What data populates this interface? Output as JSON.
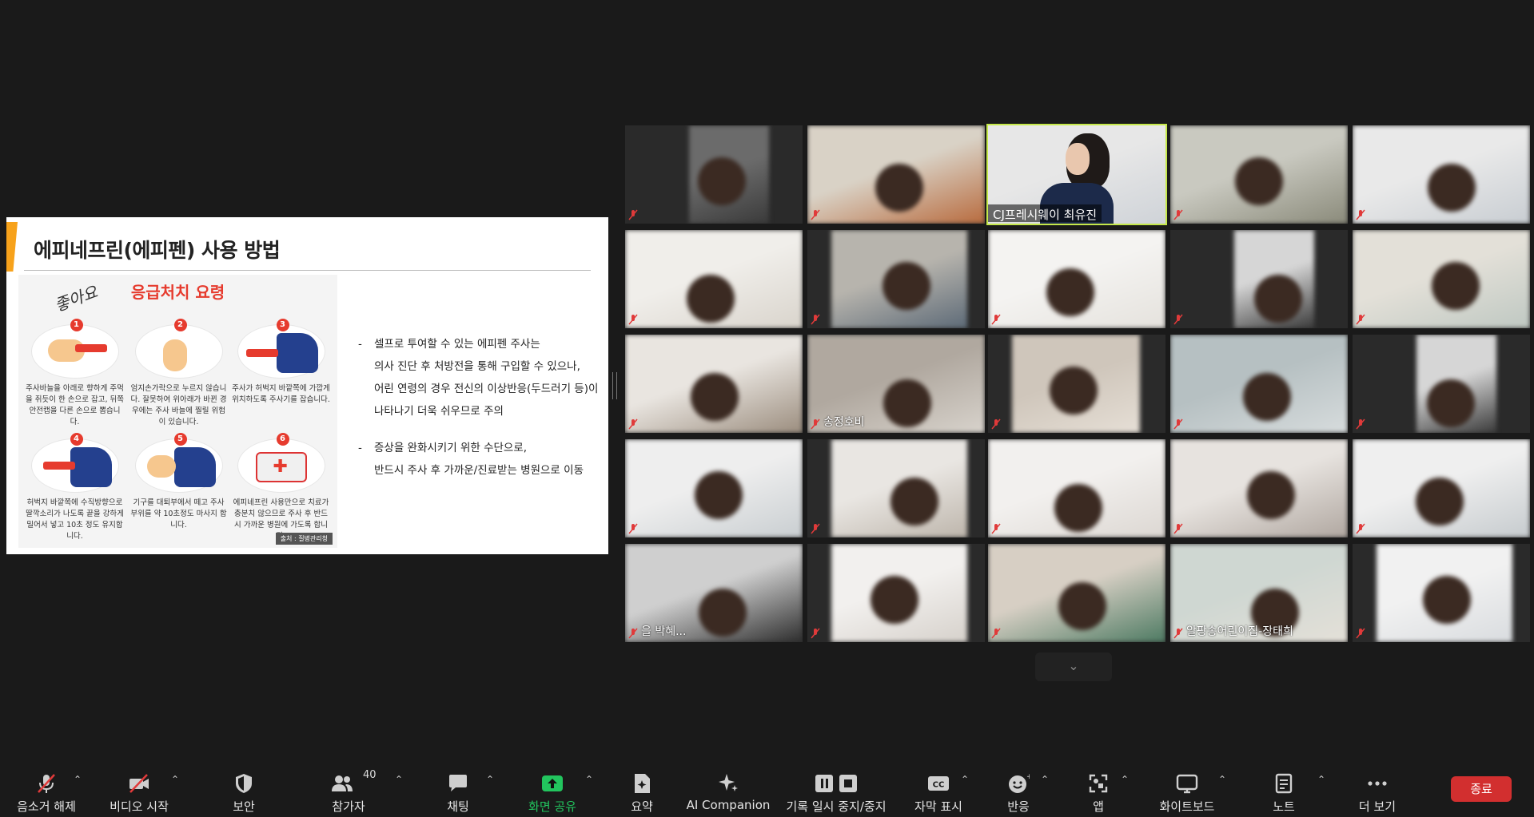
{
  "slide": {
    "title": "에피네프린(에피펜) 사용 방법",
    "panel_title": "응급처치 요령",
    "brush_text": "좋아요",
    "steps": [
      {
        "num": "1",
        "text": "주사바늘을 아래로 향하게 주먹을 쥐듯이 한 손으로 잡고, 뒤쪽 안전캡을 다른 손으로 뽑습니다."
      },
      {
        "num": "2",
        "text": "엄지손가락으로 누르지 않습니다. 잘못하여 위아래가 바뀐 경우에는 주사 바늘에 찔릴 위험이 있습니다."
      },
      {
        "num": "3",
        "text": "주사가 허벅지 바깥쪽에 가깝게 위치하도록 주사기를 잡습니다."
      },
      {
        "num": "4",
        "text": "허벅지 바깥쪽에 수직방향으로 딸깍소리가 나도록 끝을 강하게 밀어서 넣고 10초 정도 유지합니다."
      },
      {
        "num": "5",
        "text": "기구를 대퇴부에서 떼고 주사 부위를 약 10초정도 마사지 합니다."
      },
      {
        "num": "6",
        "text": "에피네프린 사용만으로 치료가 충분치 않으므로 주사 후 반드시 가까운 병원에 가도록 합니다."
      }
    ],
    "source": "출처 : 질병관리청",
    "bullets": [
      {
        "lines": [
          "셀프로 투여할 수 있는 에피펜 주사는",
          "의사 진단 후 처방전을 통해 구입할 수 있으나,",
          "어린 연령의 경우 전신의 이상반응(두드러기 등)이",
          "나타나기 더욱 쉬우므로 주의"
        ]
      },
      {
        "lines": [
          "증상을 완화시키기 위한 수단으로,",
          "반드시 주사 후 가까운/진료받는 병원으로 이동"
        ]
      }
    ]
  },
  "gallery": {
    "active_speaker": "CJ프레시웨이 최유진",
    "named_tiles": {
      "t11": "송정호비",
      "t23": "알팡송어린이집-장태희",
      "t20": "을 박혜..."
    }
  },
  "toolbar": {
    "items": [
      {
        "key": "unmute",
        "label": "음소거 해제",
        "icon": "mic-off-icon"
      },
      {
        "key": "video",
        "label": "비디오 시작",
        "icon": "video-off-icon"
      },
      {
        "key": "security",
        "label": "보안",
        "icon": "shield-icon"
      },
      {
        "key": "participants",
        "label": "참가자",
        "icon": "participants-icon",
        "count": "40"
      },
      {
        "key": "chat",
        "label": "채팅",
        "icon": "chat-icon"
      },
      {
        "key": "share",
        "label": "화면 공유",
        "icon": "share-screen-icon"
      },
      {
        "key": "summary",
        "label": "요약",
        "icon": "summary-icon"
      },
      {
        "key": "ai",
        "label": "AI Companion",
        "icon": "sparkle-icon"
      },
      {
        "key": "record",
        "label": "기록 일시 중지/중지",
        "icon": "record-pause-stop-icon"
      },
      {
        "key": "captions",
        "label": "자막 표시",
        "icon": "cc-icon"
      },
      {
        "key": "reactions",
        "label": "반응",
        "icon": "emoji-icon"
      },
      {
        "key": "apps",
        "label": "앱",
        "icon": "apps-icon"
      },
      {
        "key": "whiteboard",
        "label": "화이트보드",
        "icon": "whiteboard-icon"
      },
      {
        "key": "notes",
        "label": "노트",
        "icon": "notes-icon"
      },
      {
        "key": "more",
        "label": "더 보기",
        "icon": "more-icon"
      }
    ],
    "end_label": "종료",
    "share_color": "#22c55e",
    "end_color": "#d22f2f"
  }
}
